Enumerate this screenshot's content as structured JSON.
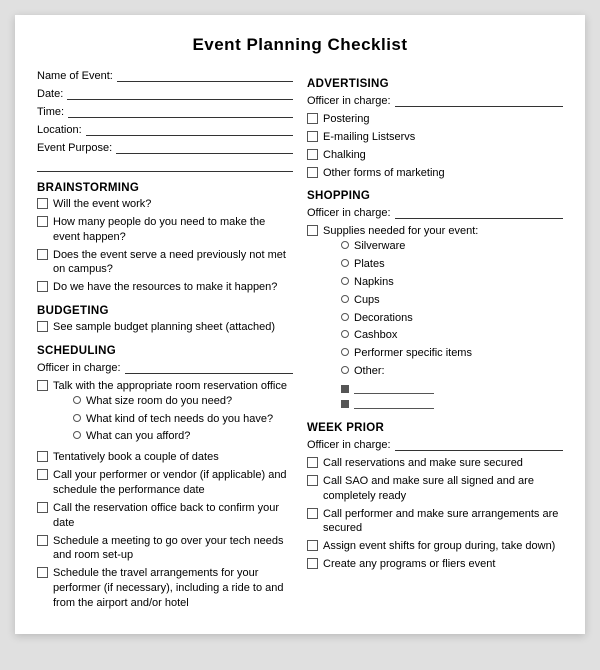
{
  "title": "Event Planning Checklist",
  "left": {
    "fields": [
      {
        "label": "Name of Event:"
      },
      {
        "label": "Date:"
      },
      {
        "label": "Time:"
      },
      {
        "label": "Location:"
      },
      {
        "label": "Event Purpose:"
      }
    ],
    "brainstorming": {
      "title": "BRAINSTORMING",
      "items": [
        "Will the event work?",
        "How many people do you need to make the event happen?",
        "Does the event serve a need previously not met on campus?",
        "Do we have the resources to make it happen?"
      ]
    },
    "budgeting": {
      "title": "BUDGETING",
      "items": [
        "See sample budget planning sheet (attached)"
      ]
    },
    "scheduling": {
      "title": "SCHEDULING",
      "officer_label": "Officer in charge:",
      "items": [
        {
          "text": "Talk with the appropriate room reservation office",
          "subitems": [
            "What size room do you need?",
            "What kind of tech needs do you have?",
            "What can you afford?"
          ]
        },
        {
          "text": "Tentatively book a couple of dates"
        },
        {
          "text": "Call your performer or vendor (if applicable) and schedule the performance date"
        },
        {
          "text": "Call the reservation office back to confirm your date"
        },
        {
          "text": "Schedule a meeting to go over your tech needs and room set-up"
        },
        {
          "text": "Schedule the travel arrangements for your performer (if necessary), including a ride to and from the airport and/or hotel"
        }
      ]
    }
  },
  "right": {
    "advertising": {
      "title": "ADVERTISING",
      "officer_label": "Officer in charge:",
      "items": [
        "Postering",
        "E-mailing Listservs",
        "Chalking",
        "Other forms of marketing"
      ]
    },
    "shopping": {
      "title": "SHOPPING",
      "officer_label": "Officer in charge:",
      "main_item": "Supplies needed for your event:",
      "subitems": [
        "Silverware",
        "Plates",
        "Napkins",
        "Cups",
        "Decorations",
        "Cashbox",
        "Performer specific items",
        "Other:"
      ],
      "blank_bullets": 2
    },
    "week_prior": {
      "title": "WEEK PRIOR",
      "officer_label": "Officer in charge:",
      "items": [
        "Call reservations and make sure secured",
        "Call SAO and make sure all signed and are completely ready",
        "Call performer and make sure arrangements are secured",
        "Assign event shifts for group during, take down)",
        "Create any programs or fliers event"
      ]
    }
  }
}
